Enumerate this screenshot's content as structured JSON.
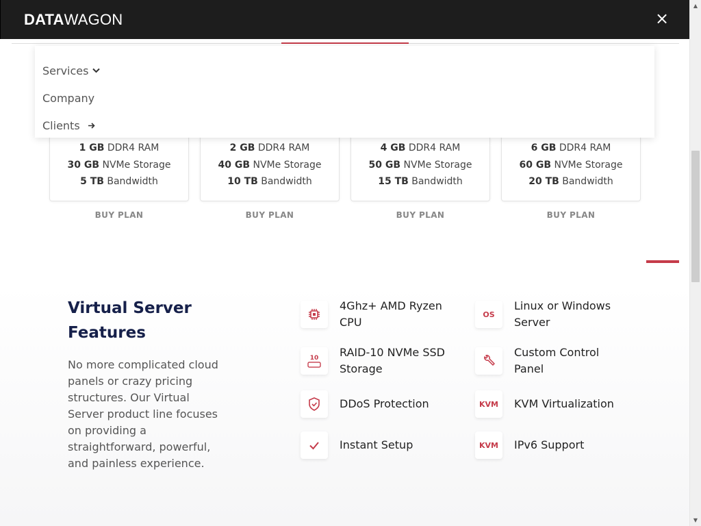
{
  "header": {
    "logo_bold": "DATA",
    "logo_thin": "WAGON",
    "close_icon": "×"
  },
  "menu": {
    "items": [
      {
        "label": "Services",
        "icon": "chevron-down-icon",
        "glyph": "⌄"
      },
      {
        "label": "Company"
      },
      {
        "label": "Clients",
        "icon": "arrow-right-icon",
        "glyph": "➔"
      }
    ]
  },
  "plans": [
    {
      "ram_value": "1 GB",
      "ram_unit": " DDR4 RAM",
      "storage_value": "30 GB",
      "storage_unit": " NVMe Storage",
      "bandwidth_value": "5 TB",
      "bandwidth_unit": " Bandwidth",
      "buy_label": "BUY PLAN"
    },
    {
      "ram_value": "2 GB",
      "ram_unit": " DDR4 RAM",
      "storage_value": "40 GB",
      "storage_unit": " NVMe Storage",
      "bandwidth_value": "10 TB",
      "bandwidth_unit": " Bandwidth",
      "buy_label": "BUY PLAN"
    },
    {
      "ram_value": "4 GB",
      "ram_unit": " DDR4 RAM",
      "storage_value": "50 GB",
      "storage_unit": " NVMe Storage",
      "bandwidth_value": "15 TB",
      "bandwidth_unit": " Bandwidth",
      "buy_label": "BUY PLAN"
    },
    {
      "ram_value": "6 GB",
      "ram_unit": " DDR4 RAM",
      "storage_value": "60 GB",
      "storage_unit": " NVMe Storage",
      "bandwidth_value": "20 TB",
      "bandwidth_unit": " Bandwidth",
      "buy_label": "BUY PLAN"
    }
  ],
  "features_section": {
    "title": "Virtual Server Features",
    "description": "No more complicated cloud panels or crazy pricing structures. Our Virtual Server product line focuses on providing a straightforward, powerful, and painless experience.",
    "items": [
      {
        "label": "4Ghz+ AMD Ryzen CPU",
        "icon": "cpu-chip-icon"
      },
      {
        "label": "Linux or Windows Server",
        "icon": "os-icon",
        "icon_text": "OS"
      },
      {
        "label": "RAID-10 NVMe SSD Storage",
        "icon": "raid-drive-icon",
        "icon_text": "10"
      },
      {
        "label": "Custom Control Panel",
        "icon": "wrench-icon"
      },
      {
        "label": "DDoS Protection",
        "icon": "shield-icon"
      },
      {
        "label": "KVM Virtualization",
        "icon": "kvm-icon",
        "icon_text": "KVM"
      },
      {
        "label": "Instant Setup",
        "icon": "checkmark-icon"
      },
      {
        "label": "IPv6 Support",
        "icon": "kvm-icon",
        "icon_text": "KVM"
      }
    ]
  },
  "colors": {
    "header_bg": "#1d1d1d",
    "accent": "#c53b4a",
    "title": "#16204a"
  }
}
